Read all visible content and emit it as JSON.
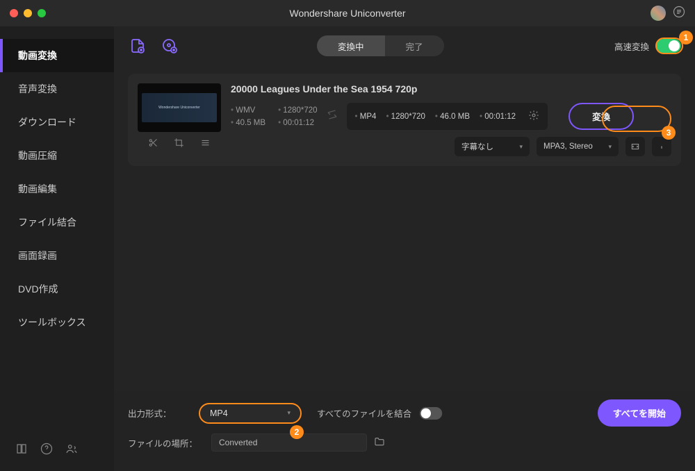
{
  "titlebar": {
    "title": "Wondershare Uniconverter"
  },
  "sidebar": {
    "items": [
      {
        "label": "動画変換",
        "active": true
      },
      {
        "label": "音声変換"
      },
      {
        "label": "ダウンロード"
      },
      {
        "label": "動画圧縮"
      },
      {
        "label": "動画編集"
      },
      {
        "label": "ファイル結合"
      },
      {
        "label": "画面録画"
      },
      {
        "label": "DVD作成"
      },
      {
        "label": "ツールボックス"
      }
    ]
  },
  "toolbar": {
    "tabs": {
      "active": "変換中",
      "inactive": "完了"
    },
    "fast_label": "高速変換"
  },
  "file": {
    "title": "20000 Leagues Under the Sea 1954 720p",
    "src": {
      "fmt": "WMV",
      "res": "1280*720",
      "size": "40.5 MB",
      "dur": "00:01:12"
    },
    "dst": {
      "fmt": "MP4",
      "res": "1280*720",
      "size": "46.0 MB",
      "dur": "00:01:12"
    },
    "subs": "字幕なし",
    "audio": "MPA3, Stereo",
    "convert_btn": "変換"
  },
  "footer": {
    "format_label": "出力形式：",
    "format_value": "MP4",
    "merge_label": "すべてのファイルを結合",
    "path_label": "ファイルの場所：",
    "path_value": "Converted",
    "start_all": "すべてを開始"
  },
  "annotations": {
    "n1": "1",
    "n2": "2",
    "n3": "3"
  }
}
